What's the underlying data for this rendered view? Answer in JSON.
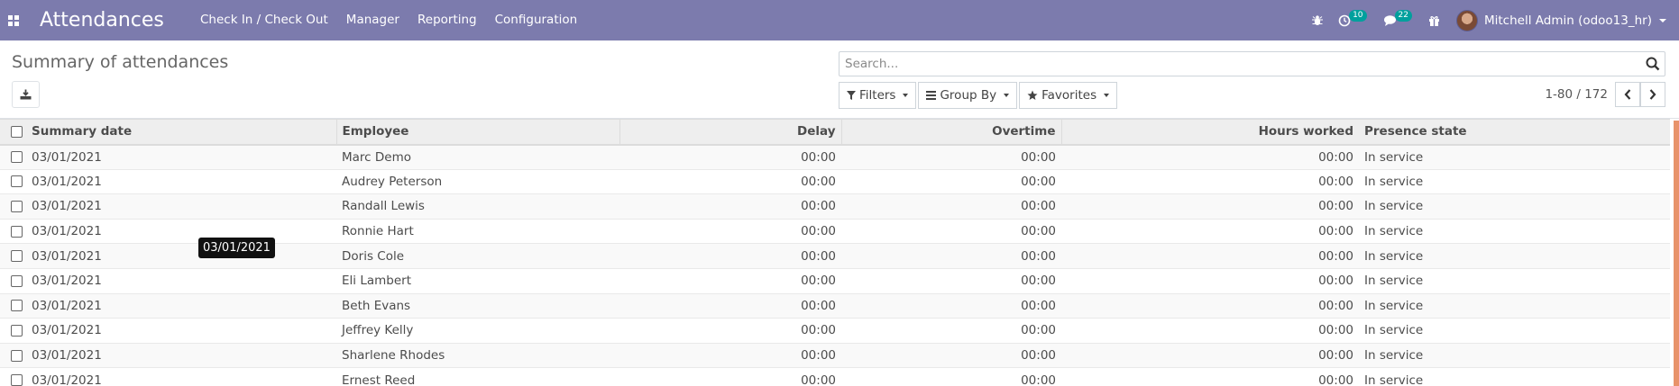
{
  "navbar": {
    "app_title": "Attendances",
    "menu": [
      "Check In / Check Out",
      "Manager",
      "Reporting",
      "Configuration"
    ],
    "activity_count": "10",
    "messages_count": "22",
    "user_name": "Mitchell Admin (odoo13_hr)"
  },
  "control_panel": {
    "title": "Summary of attendances",
    "search_placeholder": "Search...",
    "filters_label": "Filters",
    "groupby_label": "Group By",
    "favorites_label": "Favorites",
    "pager": "1-80 / 172"
  },
  "table": {
    "columns": [
      "Summary date",
      "Employee",
      "Delay",
      "Overtime",
      "Hours worked",
      "Presence state"
    ],
    "rows": [
      {
        "date": "03/01/2021",
        "employee": "Marc Demo",
        "delay": "00:00",
        "overtime": "00:00",
        "hours": "00:00",
        "state": "In service"
      },
      {
        "date": "03/01/2021",
        "employee": "Audrey Peterson",
        "delay": "00:00",
        "overtime": "00:00",
        "hours": "00:00",
        "state": "In service"
      },
      {
        "date": "03/01/2021",
        "employee": "Randall Lewis",
        "delay": "00:00",
        "overtime": "00:00",
        "hours": "00:00",
        "state": "In service"
      },
      {
        "date": "03/01/2021",
        "employee": "Ronnie Hart",
        "delay": "00:00",
        "overtime": "00:00",
        "hours": "00:00",
        "state": "In service"
      },
      {
        "date": "03/01/2021",
        "employee": "Doris Cole",
        "delay": "00:00",
        "overtime": "00:00",
        "hours": "00:00",
        "state": "In service"
      },
      {
        "date": "03/01/2021",
        "employee": "Eli Lambert",
        "delay": "00:00",
        "overtime": "00:00",
        "hours": "00:00",
        "state": "In service"
      },
      {
        "date": "03/01/2021",
        "employee": "Beth Evans",
        "delay": "00:00",
        "overtime": "00:00",
        "hours": "00:00",
        "state": "In service"
      },
      {
        "date": "03/01/2021",
        "employee": "Jeffrey Kelly",
        "delay": "00:00",
        "overtime": "00:00",
        "hours": "00:00",
        "state": "In service"
      },
      {
        "date": "03/01/2021",
        "employee": "Sharlene Rhodes",
        "delay": "00:00",
        "overtime": "00:00",
        "hours": "00:00",
        "state": "In service"
      },
      {
        "date": "03/01/2021",
        "employee": "Ernest Reed",
        "delay": "00:00",
        "overtime": "00:00",
        "hours": "00:00",
        "state": "In service"
      }
    ]
  },
  "tooltip": "03/01/2021",
  "colors": {
    "navbar": "#7c7bad",
    "badge": "#00a09d",
    "accent_bar": "#e8936b"
  }
}
